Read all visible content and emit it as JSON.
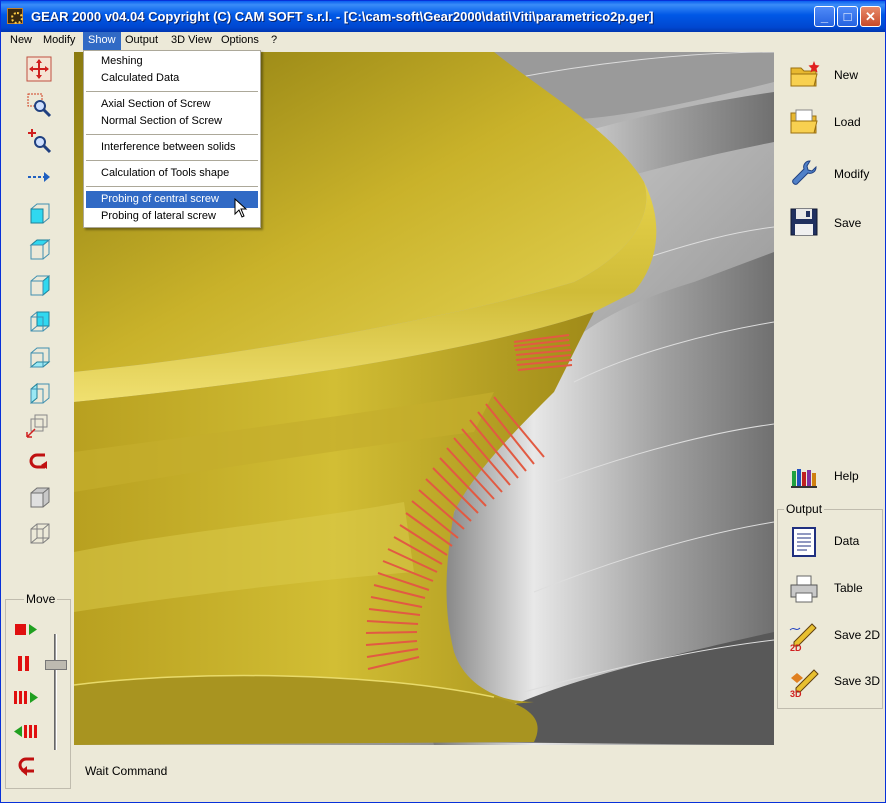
{
  "window": {
    "title": "GEAR 2000 v04.04     Copyright (C)  CAM SOFT s.r.l. - [C:\\cam-soft\\Gear2000\\dati\\Viti\\parametrico2p.ger]",
    "minimize": "_",
    "maximize": "□",
    "close": "✕"
  },
  "menubar": [
    "New",
    "Modify",
    "Show",
    "Output",
    "3D View",
    "Options",
    "?"
  ],
  "show_menu": {
    "items": [
      "Meshing",
      "Calculated Data",
      "Axial Section of Screw",
      "Normal Section of Screw",
      "Interference between solids",
      "Calculation of Tools shape",
      "Probing of central screw",
      "Probing of lateral screw"
    ],
    "highlighted": "Probing of central screw"
  },
  "left_toolbar": [
    "move-view-icon",
    "zoom-window-icon",
    "zoom-in-icon",
    "pan-arrow-icon",
    "view-front-icon",
    "view-top-icon",
    "view-side-icon",
    "view-back-icon",
    "view-bottom-icon",
    "view-right-icon",
    "view-iso-icon",
    "undo-rotate-icon",
    "solid-box-icon",
    "wire-box-icon"
  ],
  "move": {
    "label": "Move",
    "buttons": [
      "record-play-icon",
      "pause-icon",
      "step-forward-icon",
      "step-back-icon",
      "return-icon"
    ],
    "speed_level": 0.75
  },
  "right_panel": {
    "new": "New",
    "load": "Load",
    "modify": "Modify",
    "save": "Save",
    "help": "Help"
  },
  "output_panel": {
    "label": "Output",
    "data": "Data",
    "table": "Table",
    "save2d": "Save 2D",
    "save3d": "Save 3D"
  },
  "status": {
    "text": "Wait Command"
  },
  "colors": {
    "titlebar": "#0058e6",
    "menu_highlight": "#316ac5",
    "screw_yellow": "#d6c23a",
    "probe_red": "#e0503a"
  }
}
